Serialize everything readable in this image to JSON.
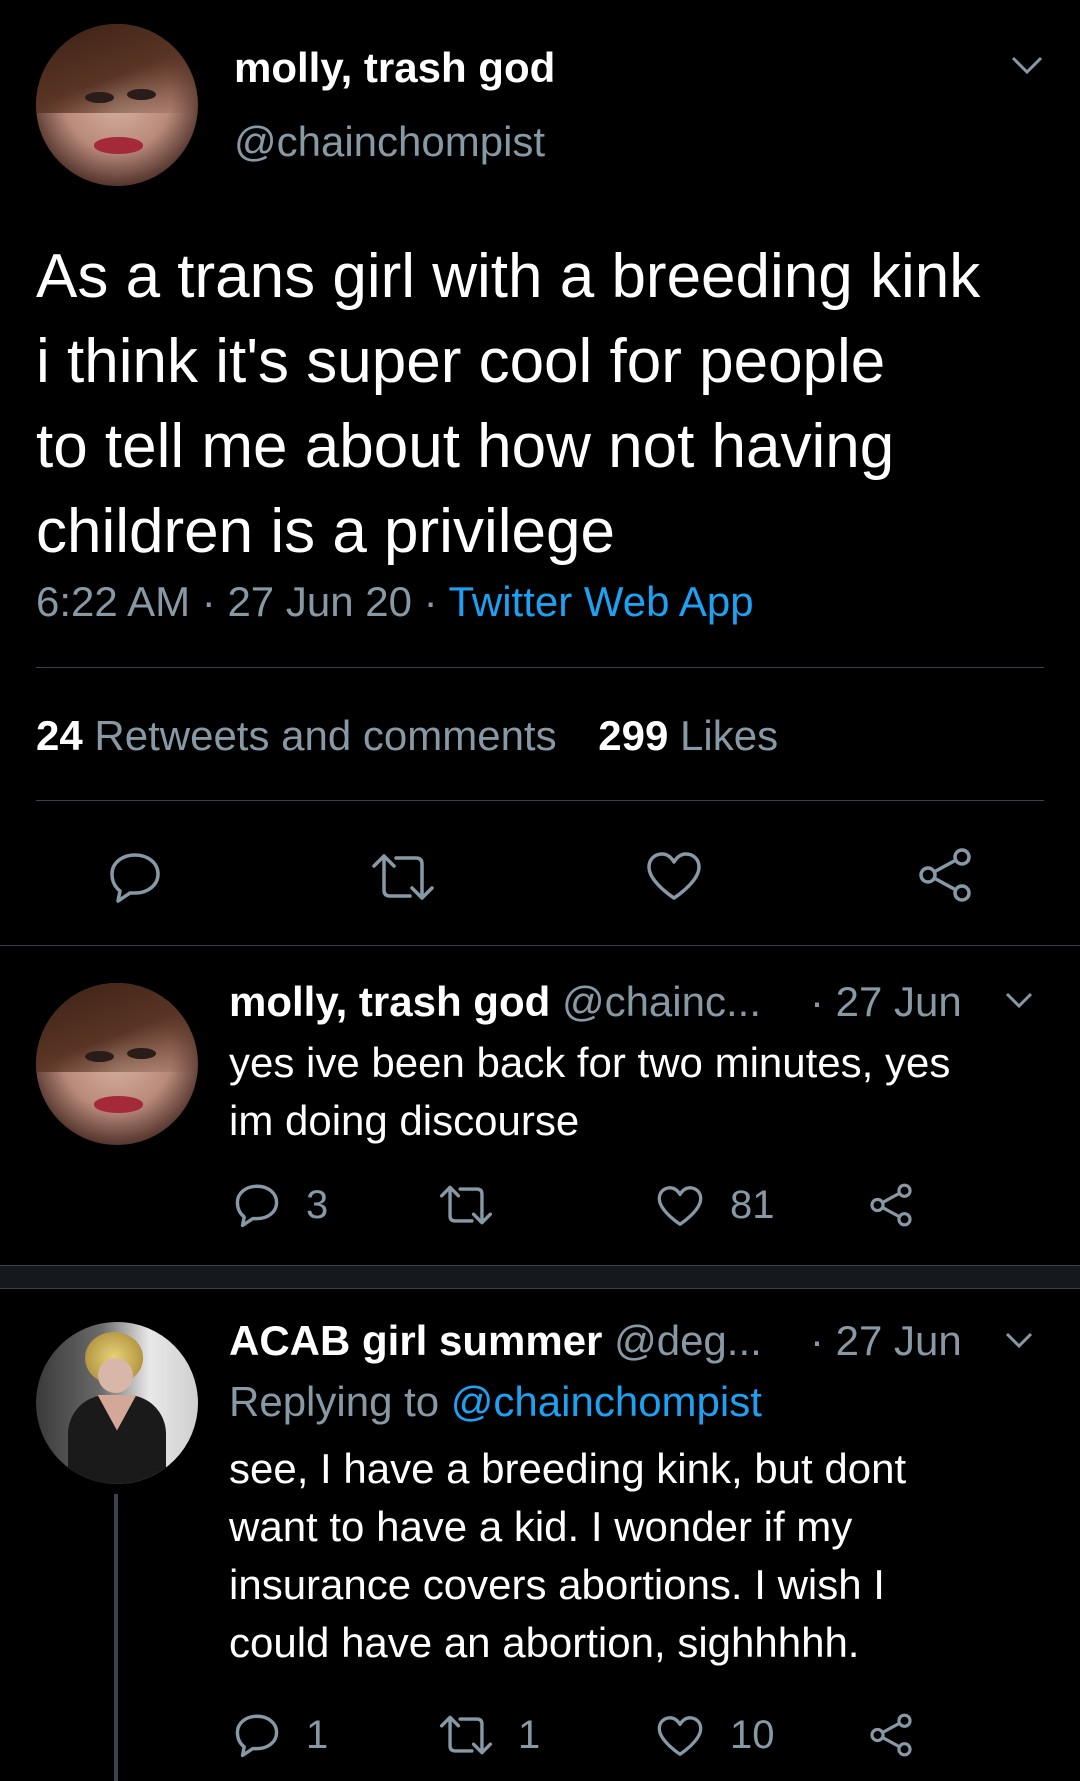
{
  "main_tweet": {
    "display_name": "molly, trash god",
    "handle": "@chainchompist",
    "text_lines": [
      "As a trans girl with a breeding kink",
      "i think it's super cool for people",
      "to tell me about how not having",
      "children is a privilege"
    ],
    "time": "6:22 AM",
    "dot1": "·",
    "date": "27 Jun 20",
    "dot2": "·",
    "source": "Twitter Web App",
    "retweets_count": "24",
    "retweets_label": "Retweets and comments",
    "likes_count": "299",
    "likes_label": "Likes",
    "icons": [
      "reply-icon",
      "retweet-icon",
      "like-icon",
      "share-icon"
    ]
  },
  "reply1": {
    "display_name": "molly, trash god",
    "handle": "@chainc...",
    "date": "· 27 Jun",
    "text_lines": [
      "yes ive been back for two minutes, yes",
      "im doing discourse"
    ],
    "reply_count": "3",
    "retweet_count": "",
    "like_count": "81"
  },
  "reply2": {
    "display_name": "ACAB girl summer",
    "handle": "@deg...",
    "date": "· 27 Jun",
    "replying_prefix": "Replying to",
    "replying_to": "@chainchompist",
    "text_lines": [
      "see, I have a breeding kink, but dont",
      "want to have a kid. I wonder if my",
      "insurance covers abortions. I wish I",
      "could have an abortion, sighhhhh."
    ],
    "reply_count": "1",
    "retweet_count": "1",
    "like_count": "10"
  },
  "colors": {
    "background": "#000000",
    "text": "#ffffff",
    "muted": "#8899a6",
    "link": "#1da1f2",
    "divider": "#38444d"
  }
}
